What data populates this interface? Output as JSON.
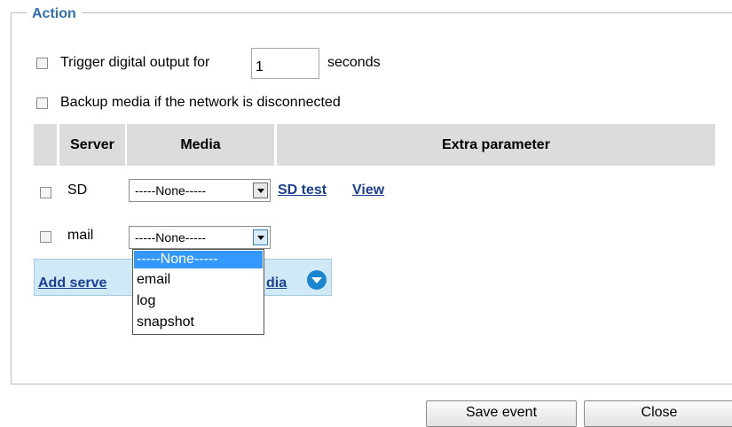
{
  "action": {
    "legend": "Action",
    "trigger": {
      "label": "Trigger digital output for",
      "value": "1",
      "unit": "seconds"
    },
    "backup": {
      "label": "Backup media if the network is disconnected"
    }
  },
  "table": {
    "headers": {
      "server": "Server",
      "media": "Media",
      "extra": "Extra parameter"
    },
    "rows": [
      {
        "server": "SD",
        "media": "-----None-----",
        "links": [
          "SD test",
          "View"
        ]
      },
      {
        "server": "mail",
        "media": "-----None-----"
      }
    ]
  },
  "add_link": {
    "part1": "Add serve",
    "part2": "dia"
  },
  "dropdown": {
    "options": [
      "-----None-----",
      "email",
      "log",
      "snapshot"
    ],
    "selected_index": 0
  },
  "buttons": {
    "save": "Save event",
    "close": "Close"
  },
  "colors": {
    "legend": "#2f6fb4",
    "link": "#1c3f96",
    "highlight": "#3399ff",
    "header_bg": "#dcdcdc",
    "add_bar_bg": "#cfe9f7",
    "circle_icon": "#1a86d0"
  }
}
